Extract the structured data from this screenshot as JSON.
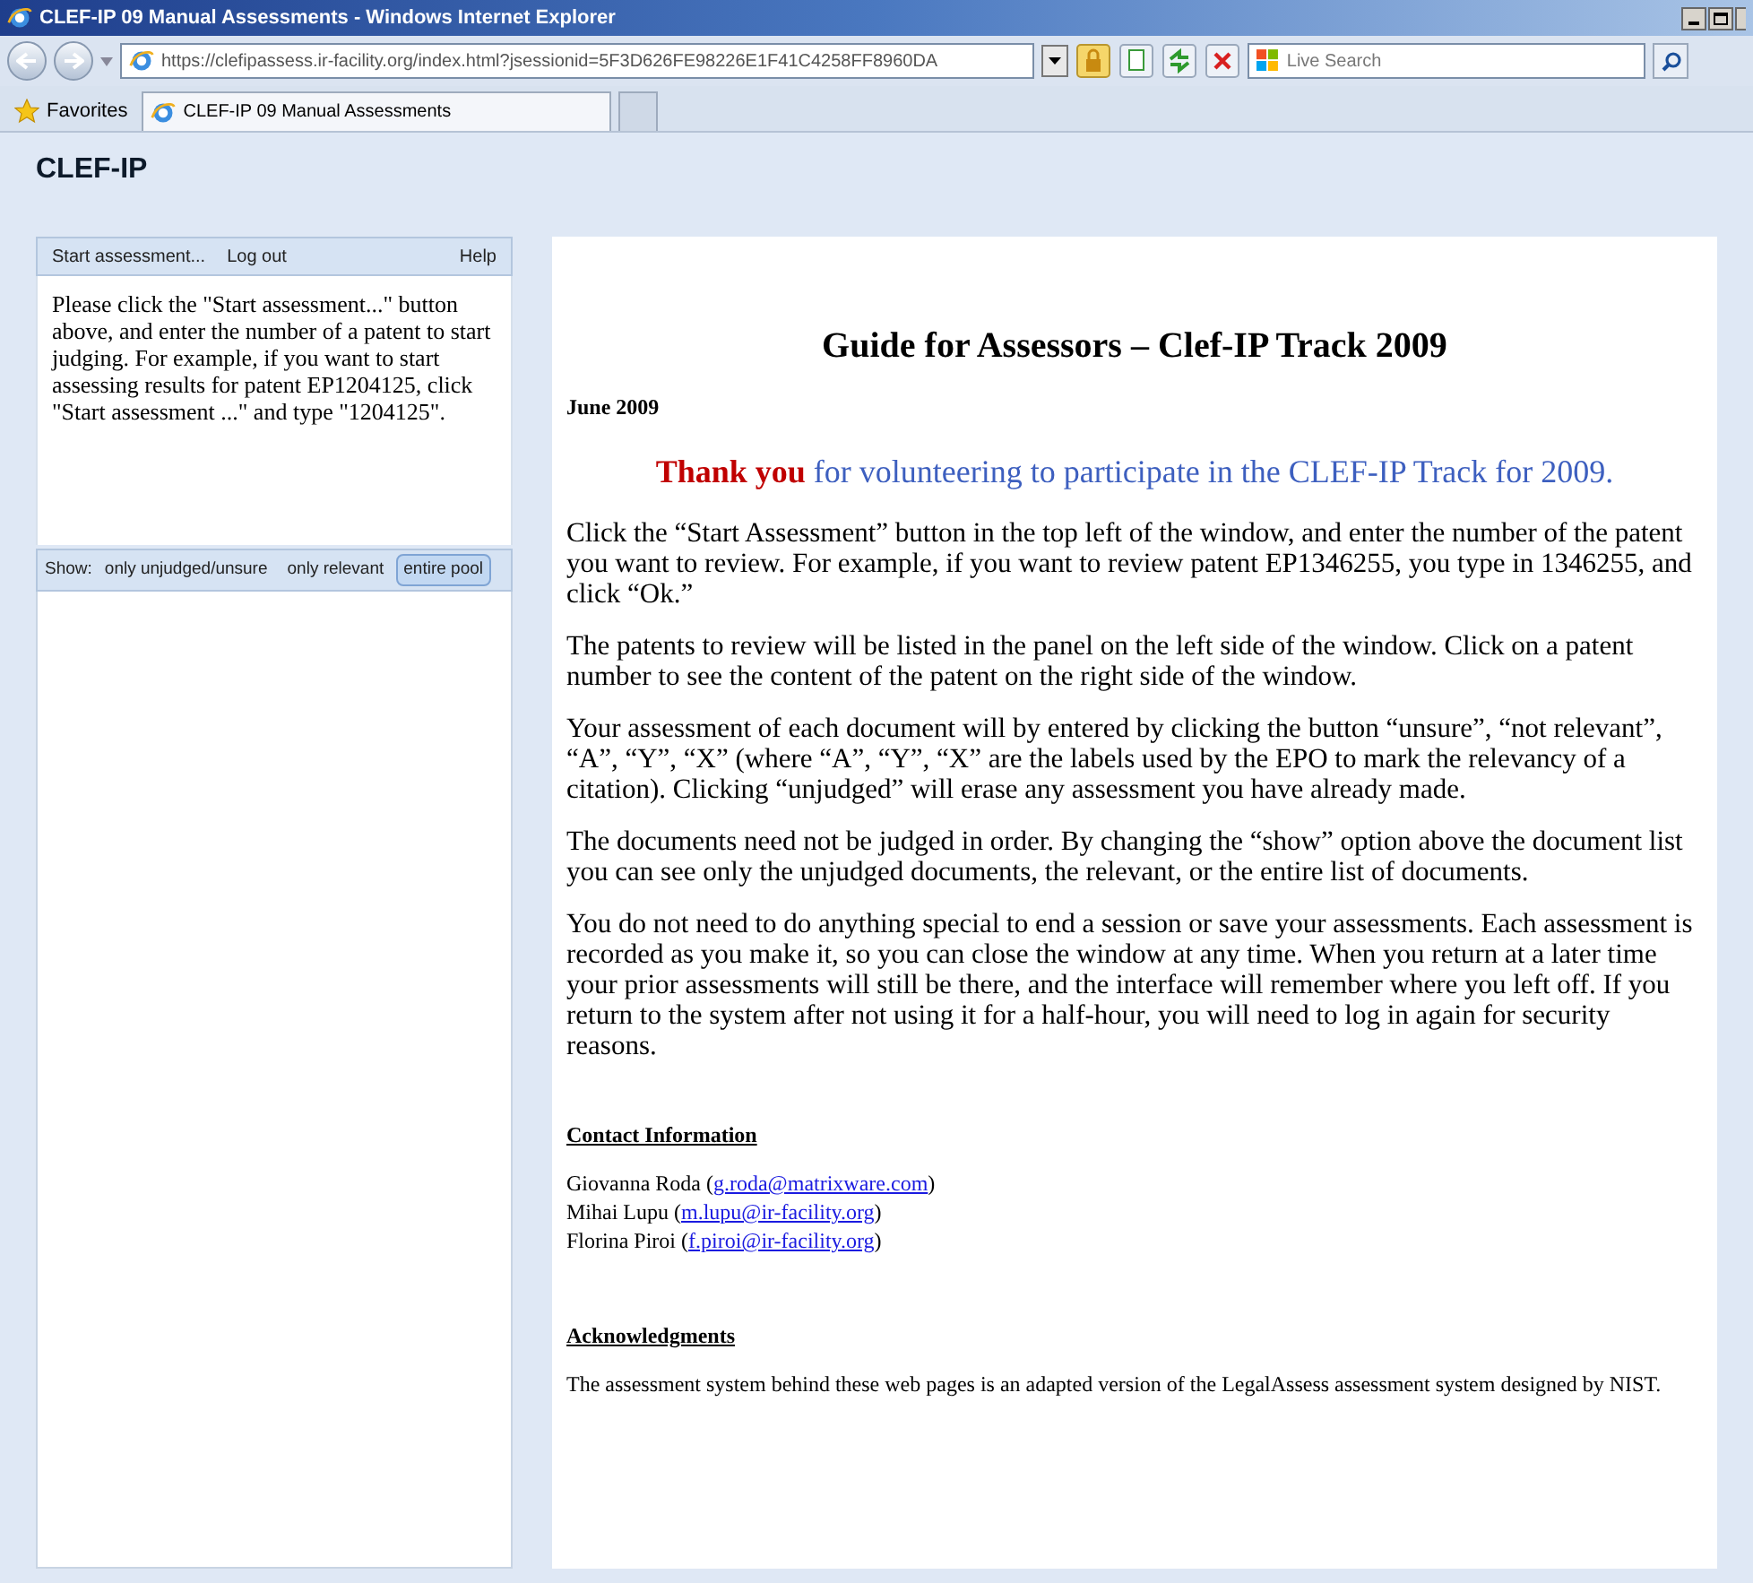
{
  "window": {
    "title": "CLEF-IP 09 Manual Assessments - Windows Internet Explorer"
  },
  "address_bar": {
    "url": "https://clefipassess.ir-facility.org/index.html?jsessionid=5F3D626FE98226E1F41C4258FF8960DA",
    "search_placeholder": "Live Search"
  },
  "favorites": {
    "label": "Favorites"
  },
  "tabs": [
    {
      "label": "CLEF-IP 09 Manual Assessments",
      "selected": true
    }
  ],
  "site_title": "CLEF-IP",
  "sidebar": {
    "menu": [
      "Start assessment...",
      "Log out"
    ],
    "help": "Help",
    "instructions": "Please click the \"Start assessment...\" button above, and enter the number of a patent to start judging. For example, if you want to start assessing results for patent EP1204125, click \"Start assessment ...\" and type \"1204125\".",
    "show_label": "Show:",
    "show_options": [
      {
        "label": "only unjudged/unsure",
        "selected": false
      },
      {
        "label": "only relevant",
        "selected": false
      },
      {
        "label": "entire pool",
        "selected": true
      }
    ]
  },
  "content": {
    "title": "Guide for Assessors – Clef-IP Track 2009",
    "date": "June 2009",
    "thanks": "**Thank you** for volunteering to participate in the CLEF-IP Track for 2009.",
    "paragraphs": [
      "Click the “Start Assessment” button in the top left of the window, and enter the number of the patent you want to review. For example, if you want to review patent EP1346255, you type in 1346255, and click “Ok.”",
      "The patents to review will be listed in the panel on the left side of the window. Click on a patent number to see the content of the patent on the right side of the window.",
      "Your assessment of each document will by entered by clicking the button “unsure”, “not relevant”, “A”, “Y”, “X” (where “A”, “Y”, “X” are the labels used by the EPO to mark the relevancy of a citation). Clicking “unjudged” will erase any assessment you have already made.",
      "The documents need not be judged in order.  By changing the “show” option above the document list you can see only the unjudged documents, the relevant, or the entire list of documents.",
      "You do not need to do anything special to end a session or save your assessments.  Each assessment is recorded as you make it, so you can close the window at any time.   When you return at a later time your prior assessments will still be there, and the interface will remember where you left off.  If you return to the system after not using it for a half-hour, you will need to log in again for security reasons."
    ],
    "contact_heading": "Contact Information",
    "contacts": [
      {
        "name": "Giovanna Roda (",
        "email": "g.roda@matrixware.com",
        "after": ")"
      },
      {
        "name": "Mihai Lupu (",
        "email": "m.lupu@ir-facility.org",
        "after": ")"
      },
      {
        "name": "Florina Piroi (",
        "email": "f.piroi@ir-facility.org",
        "after": ")"
      }
    ],
    "ack_heading": "Acknowledgments",
    "ack_text": "The assessment system behind these web pages is an adapted version of the LegalAssess assessment system designed by NIST."
  }
}
